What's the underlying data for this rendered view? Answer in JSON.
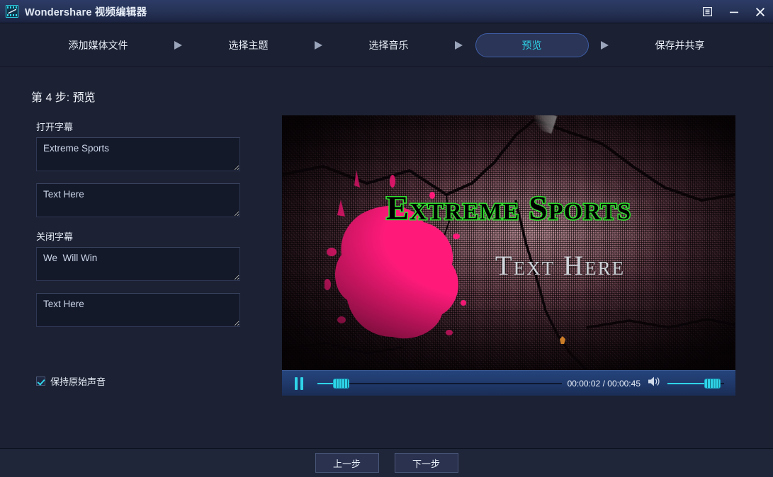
{
  "window": {
    "title": "Wondershare 视频编辑器",
    "app_icon": "filmstrip-icon",
    "controls": {
      "menu_label": "☰",
      "minimize_label": "—",
      "close_label": "✕"
    }
  },
  "steps": {
    "items": [
      {
        "label": "添加媒体文件",
        "active": false
      },
      {
        "label": "选择主题",
        "active": false
      },
      {
        "label": "选择音乐",
        "active": false
      },
      {
        "label": "预览",
        "active": true
      },
      {
        "label": "保存并共享",
        "active": false
      }
    ],
    "separator": "▶",
    "active_color": "#2fd4e8"
  },
  "page": {
    "title": "第 4 步: 预览"
  },
  "subtitles": {
    "open_label": "打开字幕",
    "open_line1": "Extreme Sports",
    "open_line1_placeholder": "Text Here",
    "open_line2": "Text Here",
    "open_line2_placeholder": "Text Here",
    "close_label": "关闭字幕",
    "close_line1": "We  Will Win",
    "close_line1_placeholder": "Text Here",
    "close_line2": "Text Here",
    "close_line2_placeholder": "Text Here"
  },
  "options": {
    "keep_audio_label": "保持原始声音",
    "keep_audio_checked": true
  },
  "preview": {
    "overlay_title": "Extreme Sports",
    "overlay_subtitle": "Text Here",
    "title_color": "#35e033",
    "subtitle_color": "#cdd3d8",
    "splatter_color": "#ff1a7a"
  },
  "player": {
    "state": "playing",
    "play_pause_icon": "pause-icon",
    "current_time": "00:00:02",
    "total_time": "00:00:45",
    "timecode": "00:00:02 / 00:00:45",
    "seek_percent": 4,
    "volume_icon": "speaker-icon",
    "volume_percent": 78,
    "accent_color": "#2fd4e8"
  },
  "footer": {
    "prev_label": "上一步",
    "next_label": "下一步"
  }
}
